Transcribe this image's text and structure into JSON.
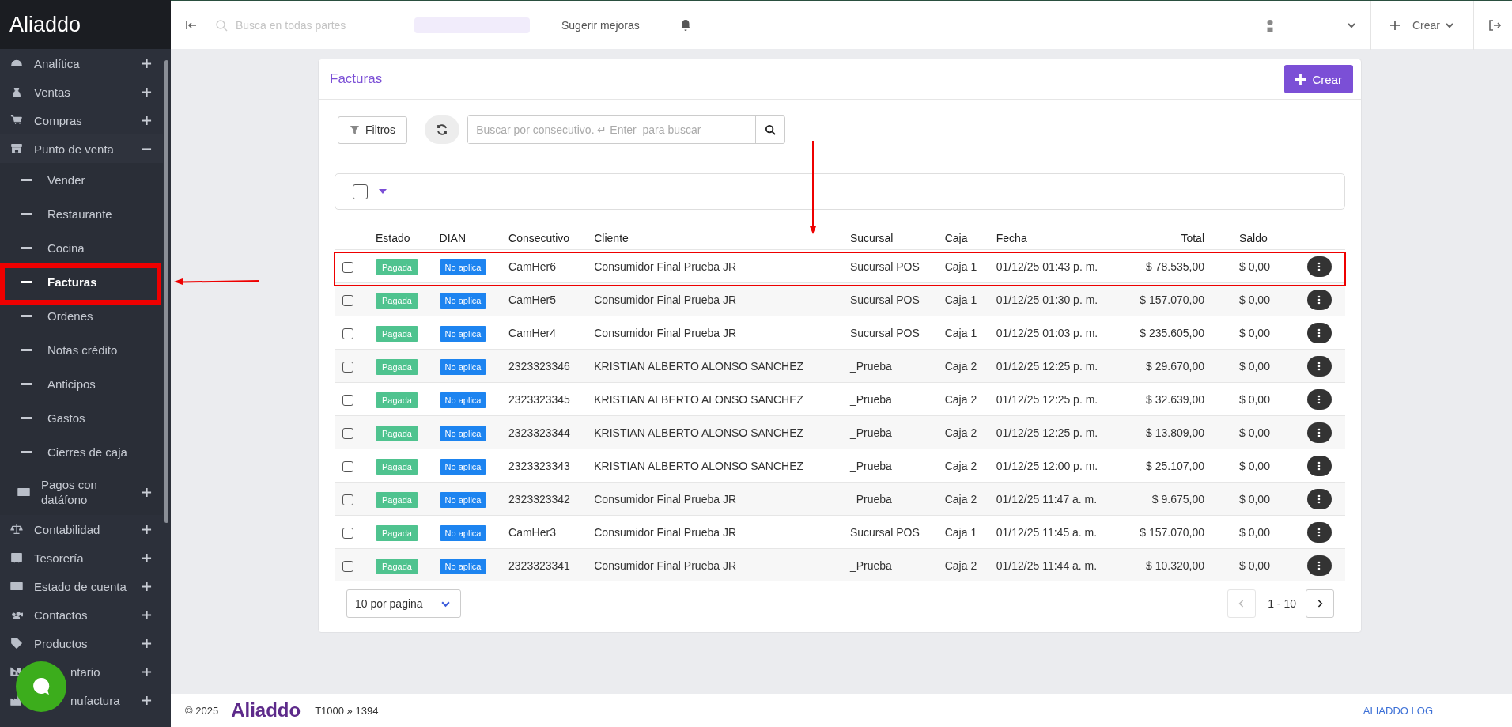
{
  "sidebar": {
    "logo": "Aliaddo",
    "items": [
      {
        "label": "Analítica",
        "kind": "group",
        "expanded": false
      },
      {
        "label": "Ventas",
        "kind": "group",
        "expanded": false
      },
      {
        "label": "Compras",
        "kind": "group",
        "expanded": false
      },
      {
        "label": "Punto de venta",
        "kind": "group",
        "expanded": true,
        "children": [
          {
            "label": "Vender",
            "selected": false
          },
          {
            "label": "Restaurante",
            "selected": false
          },
          {
            "label": "Cocina",
            "selected": false
          },
          {
            "label": "Facturas",
            "selected": true
          },
          {
            "label": "Ordenes",
            "selected": false
          },
          {
            "label": "Notas crédito",
            "selected": false
          },
          {
            "label": "Anticipos",
            "selected": false
          },
          {
            "label": "Gastos",
            "selected": false
          },
          {
            "label": "Cierres de caja",
            "selected": false
          }
        ]
      },
      {
        "label": "Pagos con datáfono",
        "kind": "subgroup",
        "expanded": false
      },
      {
        "label": "Contabilidad",
        "kind": "group",
        "expanded": false
      },
      {
        "label": "Tesorería",
        "kind": "group",
        "expanded": false
      },
      {
        "label": "Estado de cuenta",
        "kind": "group",
        "expanded": false
      },
      {
        "label": "Contactos",
        "kind": "group",
        "expanded": false
      },
      {
        "label": "Productos",
        "kind": "group",
        "expanded": false
      },
      {
        "label": "ntario",
        "kind": "covered",
        "expanded": false
      },
      {
        "label": "nufactura",
        "kind": "covered",
        "expanded": false
      }
    ]
  },
  "topbar": {
    "search_placeholder": "Busca en todas partes",
    "suggest": "Sugerir mejoras",
    "create": "Crear"
  },
  "page": {
    "title": "Facturas",
    "create_button": "Crear",
    "filters_button": "Filtros",
    "search_placeholder": "Buscar por consecutivo. ↵ Enter  para buscar",
    "columns": [
      "Estado",
      "DIAN",
      "Consecutivo",
      "Cliente",
      "Sucursal",
      "Caja",
      "Fecha",
      "Total",
      "Saldo"
    ],
    "rows": [
      {
        "estado": "Pagada",
        "dian": "No aplica",
        "consecutivo": "CamHer6",
        "cliente": "Consumidor Final Prueba JR",
        "sucursal": "Sucursal POS",
        "caja": "Caja 1",
        "fecha": "01/12/25 01:43 p. m.",
        "total": "$ 78.535,00",
        "saldo": "$ 0,00",
        "checked": false,
        "highlighted": true
      },
      {
        "estado": "Pagada",
        "dian": "No aplica",
        "consecutivo": "CamHer5",
        "cliente": "Consumidor Final Prueba JR",
        "sucursal": "Sucursal POS",
        "caja": "Caja 1",
        "fecha": "01/12/25 01:30 p. m.",
        "total": "$ 157.070,00",
        "saldo": "$ 0,00",
        "checked": false,
        "highlighted": false
      },
      {
        "estado": "Pagada",
        "dian": "No aplica",
        "consecutivo": "CamHer4",
        "cliente": "Consumidor Final Prueba JR",
        "sucursal": "Sucursal POS",
        "caja": "Caja 1",
        "fecha": "01/12/25 01:03 p. m.",
        "total": "$ 235.605,00",
        "saldo": "$ 0,00",
        "checked": false,
        "highlighted": false
      },
      {
        "estado": "Pagada",
        "dian": "No aplica",
        "consecutivo": "2323323346",
        "cliente": "KRISTIAN ALBERTO ALONSO SANCHEZ",
        "sucursal": "_Prueba",
        "caja": "Caja 2",
        "fecha": "01/12/25 12:25 p. m.",
        "total": "$ 29.670,00",
        "saldo": "$ 0,00",
        "checked": false,
        "highlighted": false
      },
      {
        "estado": "Pagada",
        "dian": "No aplica",
        "consecutivo": "2323323345",
        "cliente": "KRISTIAN ALBERTO ALONSO SANCHEZ",
        "sucursal": "_Prueba",
        "caja": "Caja 2",
        "fecha": "01/12/25 12:25 p. m.",
        "total": "$ 32.639,00",
        "saldo": "$ 0,00",
        "checked": false,
        "highlighted": false
      },
      {
        "estado": "Pagada",
        "dian": "No aplica",
        "consecutivo": "2323323344",
        "cliente": "KRISTIAN ALBERTO ALONSO SANCHEZ",
        "sucursal": "_Prueba",
        "caja": "Caja 2",
        "fecha": "01/12/25 12:25 p. m.",
        "total": "$ 13.809,00",
        "saldo": "$ 0,00",
        "checked": false,
        "highlighted": false
      },
      {
        "estado": "Pagada",
        "dian": "No aplica",
        "consecutivo": "2323323343",
        "cliente": "KRISTIAN ALBERTO ALONSO SANCHEZ",
        "sucursal": "_Prueba",
        "caja": "Caja 2",
        "fecha": "01/12/25 12:00 p. m.",
        "total": "$ 25.107,00",
        "saldo": "$ 0,00",
        "checked": false,
        "highlighted": false
      },
      {
        "estado": "Pagada",
        "dian": "No aplica",
        "consecutivo": "2323323342",
        "cliente": "Consumidor Final Prueba JR",
        "sucursal": "_Prueba",
        "caja": "Caja 2",
        "fecha": "01/12/25 11:47 a. m.",
        "total": "$ 9.675,00",
        "saldo": "$ 0,00",
        "checked": false,
        "highlighted": false
      },
      {
        "estado": "Pagada",
        "dian": "No aplica",
        "consecutivo": "CamHer3",
        "cliente": "Consumidor Final Prueba JR",
        "sucursal": "Sucursal POS",
        "caja": "Caja 1",
        "fecha": "01/12/25 11:45 a. m.",
        "total": "$ 157.070,00",
        "saldo": "$ 0,00",
        "checked": false,
        "highlighted": false
      },
      {
        "estado": "Pagada",
        "dian": "No aplica",
        "consecutivo": "2323323341",
        "cliente": "Consumidor Final Prueba JR",
        "sucursal": "_Prueba",
        "caja": "Caja 2",
        "fecha": "01/12/25 11:44 a. m.",
        "total": "$ 10.320,00",
        "saldo": "$ 0,00",
        "checked": false,
        "highlighted": false
      }
    ],
    "page_size": "10 por pagina",
    "range": "1 - 10",
    "select_all_checked": false
  },
  "footer": {
    "copyright": "© 2025",
    "brand": "Aliaddo",
    "version": "T1000 » 1394",
    "link": "ALIADDO LOG"
  }
}
